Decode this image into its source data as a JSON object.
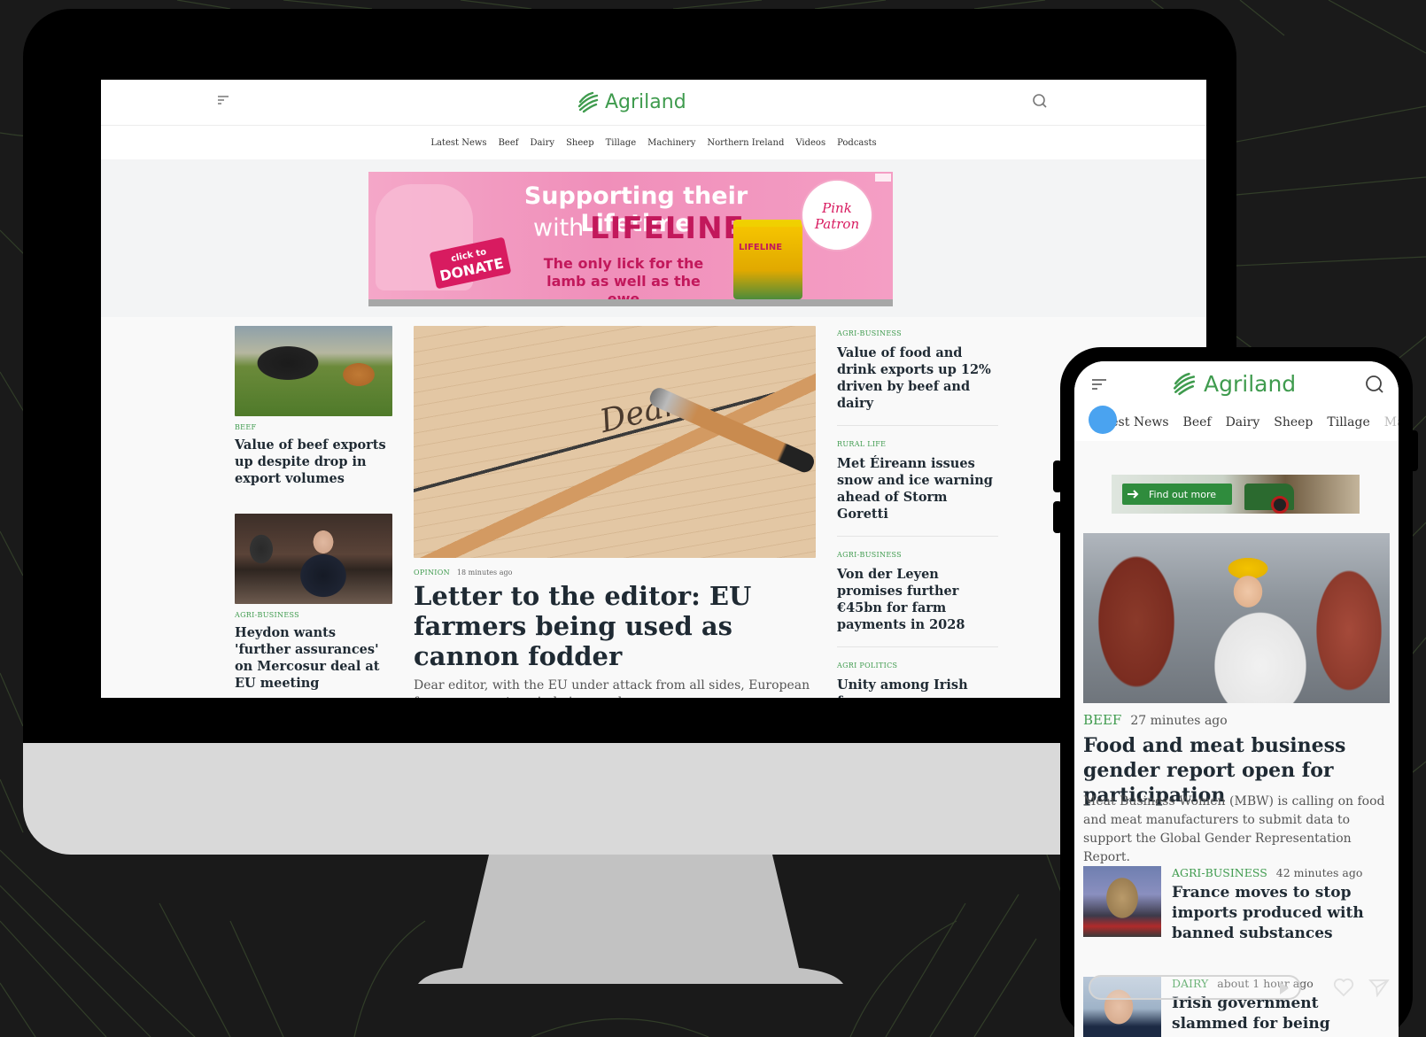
{
  "colors": {
    "brand_green": "#3f9b4e",
    "backdrop": "#1a1a1a",
    "ad_pink": "#f08fba",
    "touch_indicator": "#4aa3f0"
  },
  "desktop": {
    "logo_text": "Agriland",
    "nav": [
      "Latest News",
      "Beef",
      "Dairy",
      "Sheep",
      "Tillage",
      "Machinery",
      "Northern Ireland",
      "Videos",
      "Podcasts"
    ],
    "ad": {
      "line1": "Supporting their Lifetime",
      "line2": "with",
      "brand": "LIFELINE",
      "line3": "The only lick for the lamb as well as the ewe",
      "donate_small": "click to",
      "donate_big": "DONATE",
      "badge": "Pink Patron",
      "tub_label": "LIFELINE"
    },
    "left_articles": [
      {
        "category": "Beef",
        "title": "Value of beef exports up despite drop in export volumes"
      },
      {
        "category": "Agri-Business",
        "title": "Heydon wants 'further assurances' on Mercosur deal at EU meeting"
      }
    ],
    "lead": {
      "image_text": "Dear",
      "category": "Opinion",
      "time": "18 minutes ago",
      "title": "Letter to the editor: EU farmers being used as cannon fodder",
      "excerpt": "Dear editor, with the EU under attack from all sides, European farmers are yet again being used as..."
    },
    "right_articles": [
      {
        "category": "Agri-Business",
        "title": "Value of food and drink exports up 12% driven by beef and dairy"
      },
      {
        "category": "Rural Life",
        "title": "Met Éireann issues snow and ice warning ahead of Storm Goretti"
      },
      {
        "category": "Agri-Business",
        "title": "Von der Leyen promises further €45bn for farm payments in 2028"
      },
      {
        "category": "Agri Politics",
        "title": "Unity among Irish farm orgs strengthened ahead of Mercosur protest"
      }
    ]
  },
  "mobile": {
    "logo_text": "Agriland",
    "nav": [
      "Latest News",
      "Beef",
      "Dairy",
      "Sheep",
      "Tillage",
      "Ma"
    ],
    "ad_button": "Find out more",
    "hero": {
      "category": "Beef",
      "time": "27 minutes ago",
      "title": "Food and meat business gender report open for participation",
      "excerpt": "Meat Business Women (MBW) is calling on food and meat manufacturers to submit data to support the Global Gender Representation Report."
    },
    "items": [
      {
        "category": "Agri-Business",
        "time": "42 minutes ago",
        "title": "France moves to stop imports produced with banned substances"
      },
      {
        "category": "Dairy",
        "time": "about 1 hour ago",
        "title": "Irish government slammed for being 'marked absent' on"
      }
    ]
  }
}
